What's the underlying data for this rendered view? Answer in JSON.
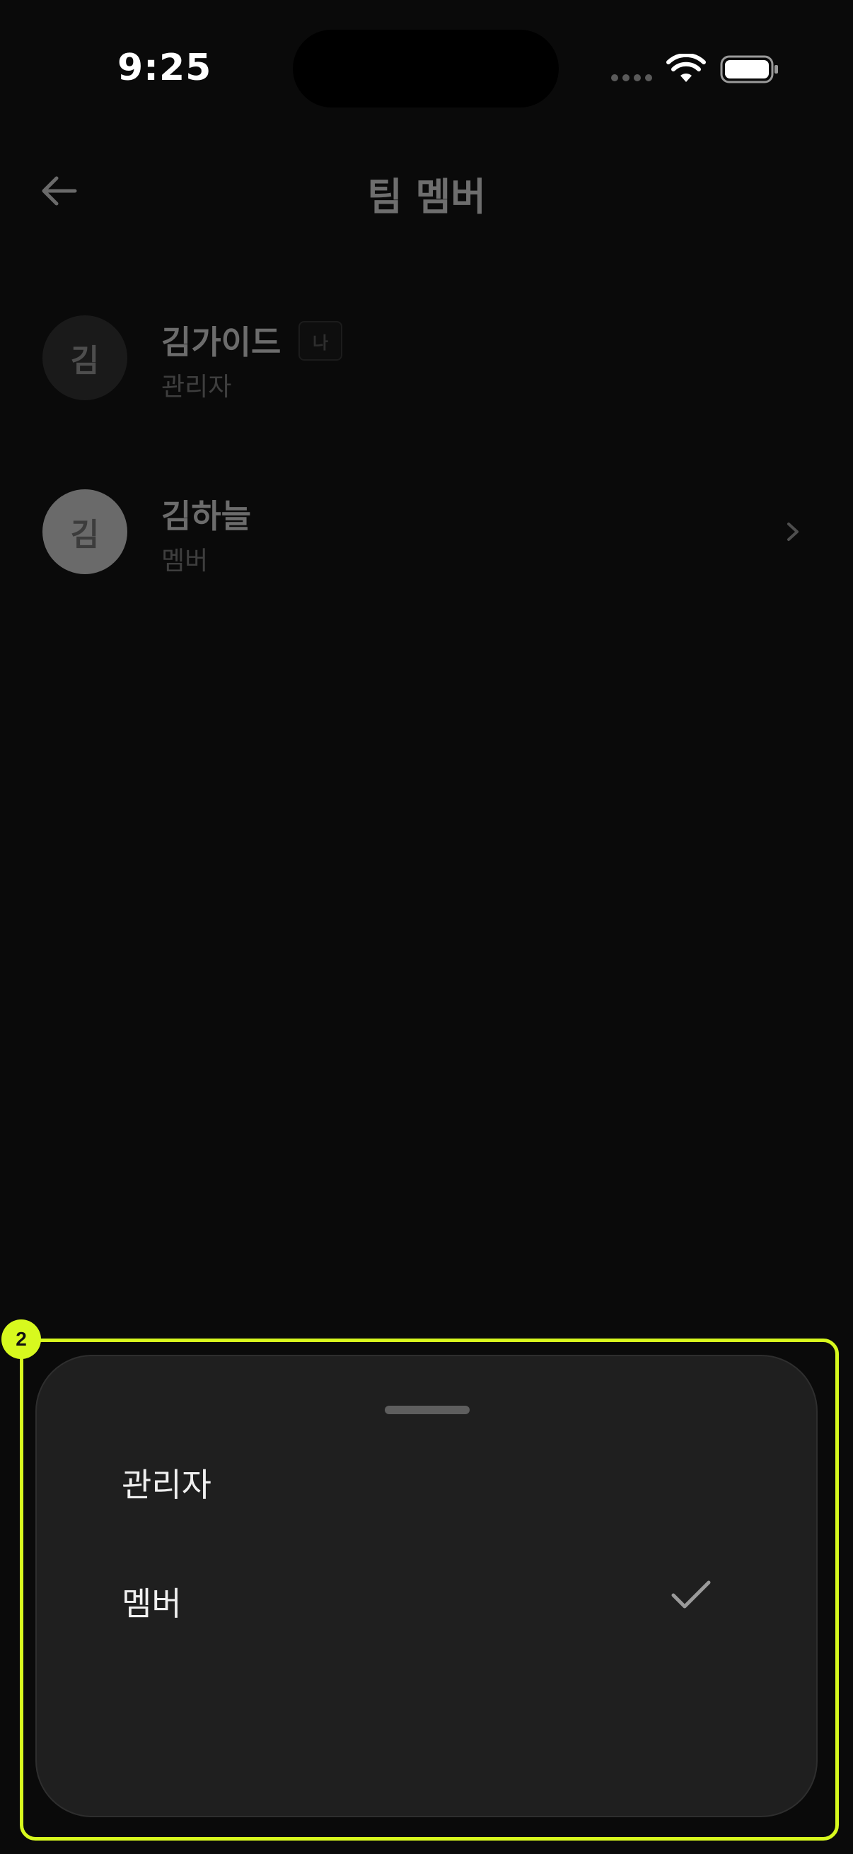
{
  "status_bar": {
    "time": "9:25"
  },
  "header": {
    "title": "팀 멤버",
    "back_icon": "arrow-left-icon"
  },
  "members": [
    {
      "avatar_initial": "김",
      "name": "김가이드",
      "badge": "나",
      "role": "관리자"
    },
    {
      "avatar_initial": "김",
      "name": "김하늘",
      "role": "멤버",
      "trailing_icon": "chevron-right-icon"
    }
  ],
  "role_sheet": {
    "highlight_number": "2",
    "highlight_color": "#d7f91e",
    "options": [
      {
        "label": "관리자",
        "selected": false
      },
      {
        "label": "멤버",
        "selected": true
      }
    ],
    "selected_icon": "checkmark-icon"
  }
}
